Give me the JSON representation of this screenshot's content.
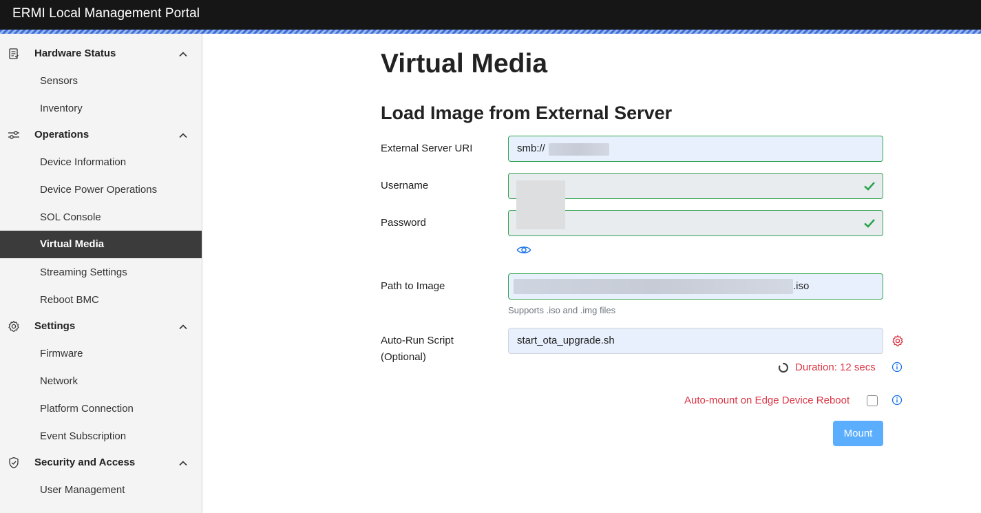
{
  "app": {
    "title": "ERMI Local Management Portal"
  },
  "sidebar": {
    "groups": [
      {
        "label": "Hardware Status",
        "icon": "clipboard-list-icon",
        "items": [
          "Sensors",
          "Inventory"
        ]
      },
      {
        "label": "Operations",
        "icon": "sliders-icon",
        "items": [
          "Device Information",
          "Device Power Operations",
          "SOL Console",
          "Virtual Media",
          "Streaming Settings",
          "Reboot BMC"
        ]
      },
      {
        "label": "Settings",
        "icon": "gear-icon",
        "items": [
          "Firmware",
          "Network",
          "Platform Connection",
          "Event Subscription"
        ]
      },
      {
        "label": "Security and Access",
        "icon": "shield-check-icon",
        "items": [
          "User Management"
        ]
      }
    ],
    "active_item": "Virtual Media"
  },
  "page": {
    "title": "Virtual Media",
    "section_title": "Load Image from External Server"
  },
  "form": {
    "uri_label": "External Server URI",
    "uri_value": "smb://",
    "username_label": "Username",
    "password_label": "Password",
    "path_label": "Path to Image",
    "path_suffix": ".iso",
    "path_hint": "Supports .iso and .img files",
    "script_label_line1": "Auto-Run Script",
    "script_label_line2": "(Optional)",
    "script_value": "start_ota_upgrade.sh",
    "duration_text": "Duration: 12 secs",
    "automount_label": "Auto-mount on Edge Device Reboot",
    "automount_checked": false,
    "mount_button": "Mount"
  },
  "colors": {
    "accent": "#3d6fd9",
    "valid_border": "#2ea44f",
    "error_text": "#dc3545",
    "button": "#5aaefd",
    "active_nav": "#3b3b3b"
  }
}
